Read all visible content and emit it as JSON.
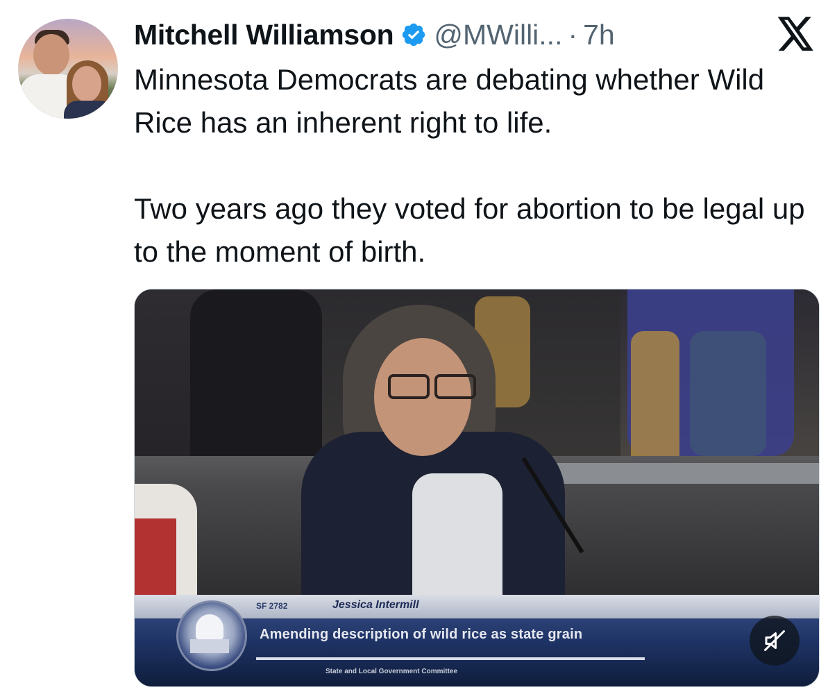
{
  "author": {
    "display_name": "Mitchell Williamson",
    "handle": "@MWilli...",
    "separator": "·",
    "timestamp": "7h",
    "verified": true,
    "verified_color": "#1d9bf0"
  },
  "brand": {
    "icon": "x-logo-icon"
  },
  "tweet": {
    "paragraphs": [
      "Minnesota Democrats are debating whether Wild Rice has an inherent right to life.",
      "Two years ago they voted for abortion to be legal up to the moment of birth."
    ]
  },
  "media": {
    "type": "video",
    "lower_third": {
      "tag": "SF 2782",
      "speaker": "Jessica Intermill",
      "caption": "Amending description of wild rice as state grain",
      "footer": "State and Local Government Committee"
    },
    "mute_icon": "speaker-muted-icon"
  }
}
